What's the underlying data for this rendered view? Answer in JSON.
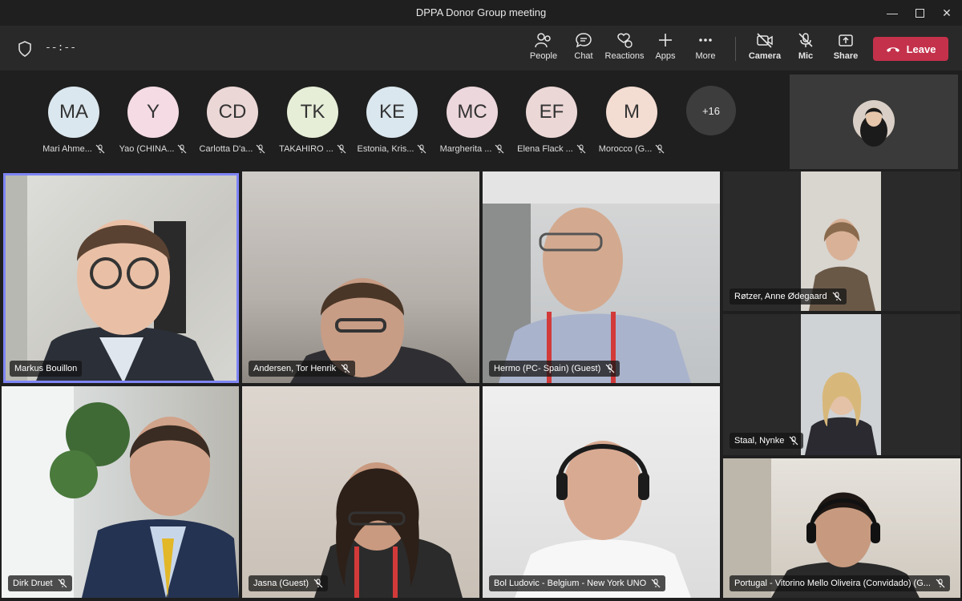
{
  "window": {
    "title": "DPPA Donor Group meeting"
  },
  "toolbar": {
    "timer": "--:--",
    "items": [
      {
        "label": "People",
        "icon": "people-icon"
      },
      {
        "label": "Chat",
        "icon": "chat-icon"
      },
      {
        "label": "Reactions",
        "icon": "reactions-icon"
      },
      {
        "label": "Apps",
        "icon": "apps-icon"
      },
      {
        "label": "More",
        "icon": "more-icon"
      },
      {
        "label": "Camera",
        "icon": "camera-off-icon"
      },
      {
        "label": "Mic",
        "icon": "mic-off-icon"
      },
      {
        "label": "Share",
        "icon": "share-icon"
      }
    ],
    "leave_label": "Leave",
    "leave_color": "#c4314b"
  },
  "participants": [
    {
      "initials": "MA",
      "name": "Mari Ahme...",
      "color": "#dbe7ee"
    },
    {
      "initials": "Y",
      "name": "Yao (CHINA...",
      "color": "#f5dbe4"
    },
    {
      "initials": "CD",
      "name": "Carlotta D'a...",
      "color": "#ecd7d7"
    },
    {
      "initials": "TK",
      "name": "TAKAHIRO ...",
      "color": "#e6eed7"
    },
    {
      "initials": "KE",
      "name": "Estonia, Kris...",
      "color": "#dbe7ee"
    },
    {
      "initials": "MC",
      "name": "Margherita ...",
      "color": "#ecd7dc"
    },
    {
      "initials": "EF",
      "name": "Elena Flack ...",
      "color": "#ecd7d7"
    },
    {
      "initials": "M",
      "name": "Morocco (G...",
      "color": "#f3dcd2"
    }
  ],
  "overflow_count": "+16",
  "tiles": [
    {
      "name": "Markus Bouillon",
      "muted": false
    },
    {
      "name": "Andersen, Tor Henrik",
      "muted": true
    },
    {
      "name": "Hermo (PC- Spain) (Guest)",
      "muted": true
    },
    {
      "name": "Røtzer, Anne Ødegaard",
      "muted": true
    },
    {
      "name": "Staal, Nynke",
      "muted": true
    },
    {
      "name": "Dirk Druet",
      "muted": true
    },
    {
      "name": "Jasna (Guest)",
      "muted": true
    },
    {
      "name": "Bol Ludovic - Belgium - New York UNO",
      "muted": true
    },
    {
      "name": "Portugal - Vitorino Mello Oliveira (Convidado) (G...",
      "muted": true
    }
  ],
  "accent_color": "#7f85f5"
}
